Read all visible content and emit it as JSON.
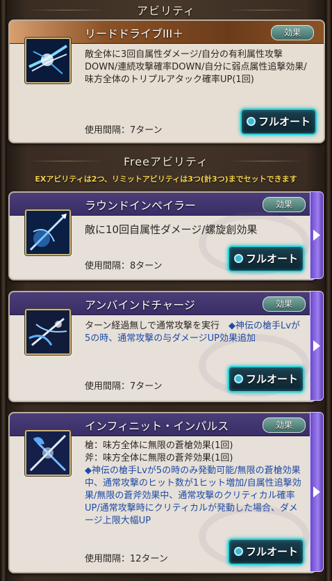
{
  "sections": {
    "ability_title": "アビリティ",
    "free_title": "Freeアビリティ",
    "notice": "EXアビリティは2つ、リミットアビリティは3つ(計3つ)までセットできます"
  },
  "common": {
    "effect_label": "効果",
    "full_auto_label": "フルオート"
  },
  "main_ability": {
    "name": "リードドライブIII＋",
    "description": "敵全体に3回自属性ダメージ/自分の有利属性攻撃DOWN/連続攻撃確率DOWN/自分に弱点属性追撃効果/味方全体のトリプルアタック確率UP(1回)",
    "cooldown": "使用間隔：7ターン",
    "icon": "blue-lightning-slash-icon"
  },
  "free_abilities": [
    {
      "name": "ラウンドインペイラー",
      "description": "敵に10回自属性ダメージ/螺旋創効果",
      "cooldown": "使用間隔：8ターン",
      "icon": "spear-thrust-icon"
    },
    {
      "name": "アンバインドチャージ",
      "description": "ターン経過無しで通常攻撃を実行　",
      "description_note": "◆神伝の槍手Lvが5の時、通常攻撃の与ダメージUP効果追加",
      "cooldown": "使用間隔：7ターン",
      "icon": "charging-spear-icon"
    },
    {
      "name": "インフィニット・インパルス",
      "description_line1": "槍：味方全体に無限の蒼槍効果(1回)",
      "description_line2": "斧：味方全体に無限の蒼斧効果(1回)",
      "description_note": "◆神伝の槍手Lvが5の時のみ発動可能/無限の蒼槍効果中、通常攻撃のヒット数が1ヒット増加/自属性追撃効果/無限の蒼斧効果中、通常攻撃のクリティカル確率UP/通常攻撃時にクリティカルが発動した場合、ダメージ上限大幅UP",
      "cooldown": "使用間隔：12ターン",
      "icon": "spear-and-axe-icon"
    }
  ],
  "colors": {
    "main_header": "#8a5226",
    "free_header": "#3a2e66",
    "accent_cyan": "#2bd0d8",
    "notice_yellow": "#f5d44a",
    "note_blue": "#1f4aa6"
  }
}
